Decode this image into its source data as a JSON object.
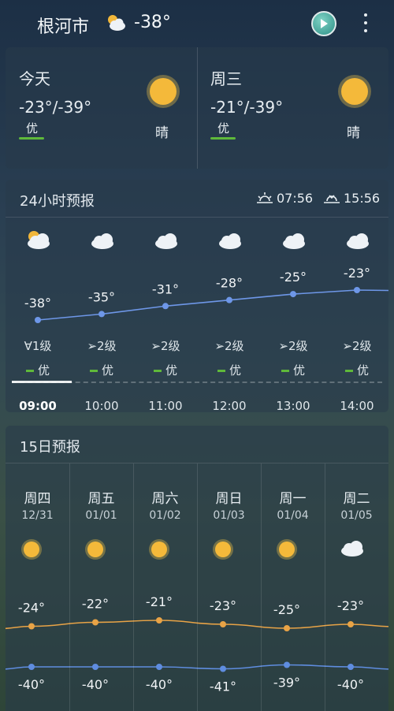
{
  "header": {
    "city": "根河市",
    "weather_icon": "partly-cloudy-icon",
    "temp": "-38°"
  },
  "today": [
    {
      "name": "今天",
      "range": "-23°/-39°",
      "aqi": "优",
      "cond": "晴",
      "icon": "sun-icon"
    },
    {
      "name": "周三",
      "range": "-21°/-39°",
      "aqi": "优",
      "cond": "晴",
      "icon": "sun-icon"
    }
  ],
  "hourly": {
    "title": "24小时预报",
    "sunrise": "07:56",
    "sunset": "15:56",
    "items": [
      {
        "time": "09:00",
        "temp": "-38°",
        "t": -38,
        "wind": "∀1级",
        "aqi": "优",
        "icon": "sun-cloud-icon"
      },
      {
        "time": "10:00",
        "temp": "-35°",
        "t": -35,
        "wind": "➢2级",
        "aqi": "优",
        "icon": "cloud-icon"
      },
      {
        "time": "11:00",
        "temp": "-31°",
        "t": -31,
        "wind": "➢2级",
        "aqi": "优",
        "icon": "cloud-icon"
      },
      {
        "time": "12:00",
        "temp": "-28°",
        "t": -28,
        "wind": "➢2级",
        "aqi": "优",
        "icon": "cloud-icon"
      },
      {
        "time": "13:00",
        "temp": "-25°",
        "t": -25,
        "wind": "➢2级",
        "aqi": "优",
        "icon": "cloud-icon"
      },
      {
        "time": "14:00",
        "temp": "-23°",
        "t": -23,
        "wind": "➢2级",
        "aqi": "优",
        "icon": "cloud-icon"
      }
    ]
  },
  "daily": {
    "title": "15日预报",
    "items": [
      {
        "week": "周四",
        "date": "12/31",
        "hi": "-24°",
        "h": -24,
        "lo": "-40°",
        "l": -40,
        "icon": "sun-icon"
      },
      {
        "week": "周五",
        "date": "01/01",
        "hi": "-22°",
        "h": -22,
        "lo": "-40°",
        "l": -40,
        "icon": "sun-icon"
      },
      {
        "week": "周六",
        "date": "01/02",
        "hi": "-21°",
        "h": -21,
        "lo": "-40°",
        "l": -40,
        "icon": "sun-icon"
      },
      {
        "week": "周日",
        "date": "01/03",
        "hi": "-23°",
        "h": -23,
        "lo": "-41°",
        "l": -41,
        "icon": "sun-icon"
      },
      {
        "week": "周一",
        "date": "01/04",
        "hi": "-25°",
        "h": -25,
        "lo": "-39°",
        "l": -39,
        "icon": "sun-icon"
      },
      {
        "week": "周二",
        "date": "01/05",
        "hi": "-23°",
        "h": -23,
        "lo": "-40°",
        "l": -40,
        "icon": "cloud-icon"
      }
    ]
  },
  "colors": {
    "accent_aqi": "#5fb93a",
    "hi_line": "#e8a346",
    "lo_line": "#5f8de0",
    "hourly_line": "#6e97e8"
  }
}
